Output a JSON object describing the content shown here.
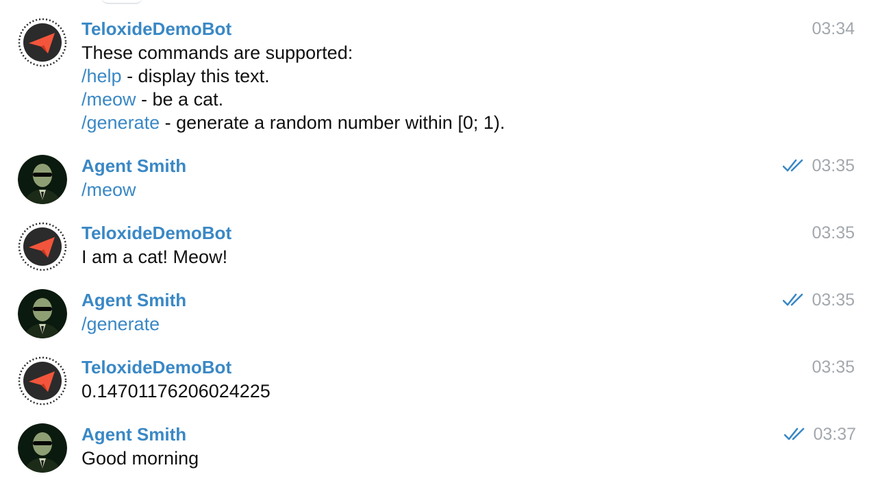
{
  "colors": {
    "accent": "#3a88c5",
    "time": "#a3a8ad",
    "text": "#111111"
  },
  "messages": [
    {
      "sender": "TeloxideDemoBot",
      "avatar": "teloxide-bot-logo",
      "time": "03:34",
      "read": false,
      "lines": [
        {
          "text": "These commands are supported:"
        },
        {
          "cmd": "/help",
          "text": " - display this text."
        },
        {
          "cmd": "/meow",
          "text": " - be a cat."
        },
        {
          "cmd": "/generate",
          "text": " - generate a random number within [0; 1)."
        }
      ]
    },
    {
      "sender": "Agent Smith",
      "avatar": "agent-smith-photo",
      "time": "03:35",
      "read": true,
      "lines": [
        {
          "cmd": "/meow"
        }
      ]
    },
    {
      "sender": "TeloxideDemoBot",
      "avatar": "teloxide-bot-logo",
      "time": "03:35",
      "read": false,
      "lines": [
        {
          "text": "I am a cat! Meow!"
        }
      ]
    },
    {
      "sender": "Agent Smith",
      "avatar": "agent-smith-photo",
      "time": "03:35",
      "read": true,
      "lines": [
        {
          "cmd": "/generate"
        }
      ]
    },
    {
      "sender": "TeloxideDemoBot",
      "avatar": "teloxide-bot-logo",
      "time": "03:35",
      "read": false,
      "lines": [
        {
          "text": "0.14701176206024225"
        }
      ]
    },
    {
      "sender": "Agent Smith",
      "avatar": "agent-smith-photo",
      "time": "03:37",
      "read": true,
      "lines": [
        {
          "text": "Good morning"
        }
      ]
    }
  ]
}
